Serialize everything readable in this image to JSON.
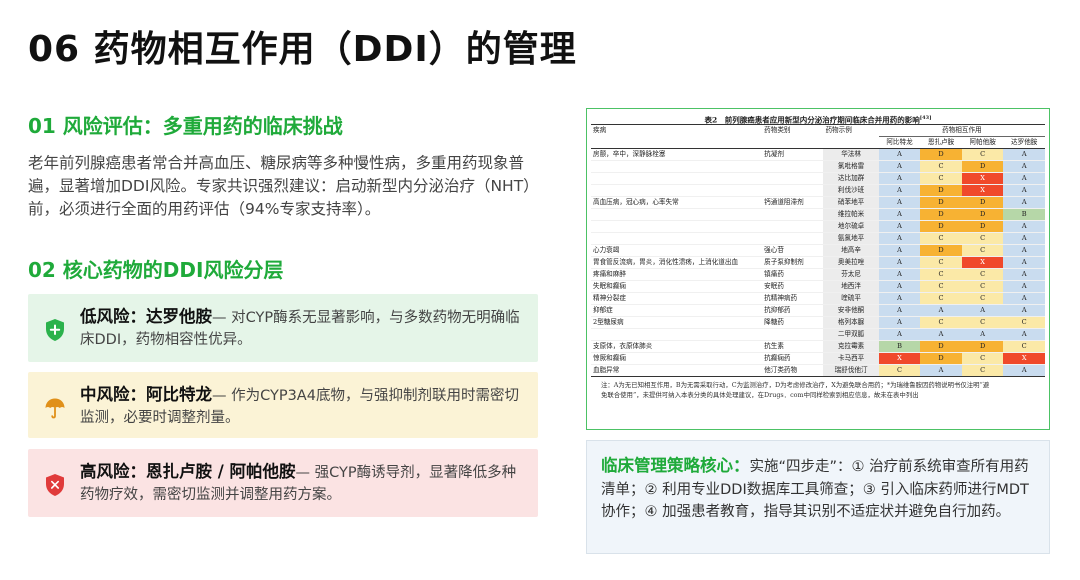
{
  "page": {
    "title": "06 药物相互作用（DDI）的管理"
  },
  "section1": {
    "heading": "01 风险评估：多重用药的临床挑战",
    "body": "老年前列腺癌患者常合并高血压、糖尿病等多种慢性病，多重用药现象普遍，显著增加DDI风险。专家共识强烈建议：启动新型内分泌治疗（NHT）前，必须进行全面的用药评估（94%专家支持率）。"
  },
  "section2": {
    "heading": "02 核心药物的DDI风险分层",
    "cards": [
      {
        "level": "低风险：达罗他胺",
        "desc": "— 对CYP酶系无显著影响，与多数药物无明确临床DDI，药物相容性优异。",
        "icon": "shield-plus-icon",
        "color": "#2bb24c"
      },
      {
        "level": "中风险：阿比特龙",
        "desc": "— 作为CYP3A4底物，与强抑制剂联用时需密切监测，必要时调整剂量。",
        "icon": "umbrella-icon",
        "color": "#e0901a"
      },
      {
        "level": "高风险：恩扎卢胺 / 阿帕他胺",
        "desc": "— 强CYP酶诱导剂，显著降低多种药物疗效，需密切监测并调整用药方案。",
        "icon": "shield-x-icon",
        "color": "#e03b3b"
      }
    ]
  },
  "table": {
    "caption": "表2　前列腺癌患者应用新型内分泌治疗期间临床合并用药的影响",
    "caption_sup": "[43]",
    "headers": {
      "disease": "疾病",
      "drug_class": "药物类别",
      "drug_example": "药物示例",
      "interaction_group": "药物相互作用",
      "cols": [
        "阿比特龙",
        "恩扎卢胺",
        "阿帕他胺",
        "达罗他胺"
      ]
    },
    "rows": [
      {
        "disease": "房颤，卒中，深静脉栓塞",
        "cls": "抗凝剂",
        "drug": "华法林",
        "r": [
          "A",
          "D",
          "C",
          "A"
        ]
      },
      {
        "disease": "",
        "cls": "",
        "drug": "氯吡格雷",
        "r": [
          "A",
          "C",
          "D",
          "A"
        ]
      },
      {
        "disease": "",
        "cls": "",
        "drug": "达比加群",
        "r": [
          "A",
          "C",
          "X",
          "A"
        ]
      },
      {
        "disease": "",
        "cls": "",
        "drug": "利伐沙班",
        "r": [
          "A",
          "D",
          "X",
          "A"
        ]
      },
      {
        "disease": "高血压病，冠心病，心率失常",
        "cls": "钙通道阻滞剂",
        "drug": "硝苯地平",
        "r": [
          "A",
          "D",
          "D",
          "A"
        ]
      },
      {
        "disease": "",
        "cls": "",
        "drug": "维拉帕米",
        "r": [
          "A",
          "D",
          "D",
          "B"
        ]
      },
      {
        "disease": "",
        "cls": "",
        "drug": "地尔硫卓",
        "r": [
          "A",
          "D",
          "D",
          "A"
        ]
      },
      {
        "disease": "",
        "cls": "",
        "drug": "氨氯地平",
        "r": [
          "A",
          "C",
          "C",
          "A"
        ]
      },
      {
        "disease": "心力衰竭",
        "cls": "强心苷",
        "drug": "地高辛",
        "r": [
          "A",
          "D",
          "C",
          "A"
        ]
      },
      {
        "disease": "胃食管反流病，胃炎，消化性溃疡，上消化道出血",
        "cls": "质子泵抑制剂",
        "drug": "奥美拉唑",
        "r": [
          "A",
          "C",
          "X",
          "A"
        ]
      },
      {
        "disease": "疼痛和麻醉",
        "cls": "镇痛药",
        "drug": "芬太尼",
        "r": [
          "A",
          "C",
          "C",
          "A"
        ]
      },
      {
        "disease": "失眠和癫痫",
        "cls": "安眠药",
        "drug": "地西泮",
        "r": [
          "A",
          "C",
          "C",
          "A"
        ]
      },
      {
        "disease": "精神分裂症",
        "cls": "抗精神病药",
        "drug": "喹硫平",
        "r": [
          "A",
          "C",
          "C",
          "A"
        ]
      },
      {
        "disease": "抑郁症",
        "cls": "抗抑郁药",
        "drug": "安非他酮",
        "r": [
          "A",
          "A",
          "A",
          "A"
        ]
      },
      {
        "disease": "2型糖尿病",
        "cls": "降糖药",
        "drug": "格列本脲",
        "r": [
          "A",
          "C",
          "C",
          "C"
        ]
      },
      {
        "disease": "",
        "cls": "",
        "drug": "二甲双胍",
        "r": [
          "A",
          "A",
          "A",
          "A"
        ]
      },
      {
        "disease": "支原体，衣原体肺炎",
        "cls": "抗生素",
        "drug": "克拉霉素",
        "r": [
          "B",
          "D",
          "D",
          "C"
        ]
      },
      {
        "disease": "惊厥和癫痫",
        "cls": "抗癫痫药",
        "drug": "卡马西平",
        "r": [
          "X",
          "D",
          "C",
          "X"
        ]
      },
      {
        "disease": "血脂异常",
        "cls": "他汀类药物",
        "drug": "瑞舒伐他汀",
        "r": [
          "C",
          "A",
          "C",
          "A"
        ]
      }
    ],
    "note_line1": "注：A为无已知相互作用，B为无需采取行动，C为监测治疗，D为考虑修改治疗，X为避免联合用药；*为瑞维鲁胺因药物说明书仅注明“避",
    "note_line2": "免联合使用”，未提供可纳入本表分类的具体处理建议，在Drugs．com中同样检索到相应信息，故未在表中列出"
  },
  "strategy": {
    "lead": "临床管理策略核心：",
    "body": "实施“四步走”：① 治疗前系统审查所有用药清单；② 利用专业DDI数据库工具筛查；③ 引入临床药师进行MDT协作；④ 加强患者教育，指导其识别不适症状并避免自行加药。"
  }
}
